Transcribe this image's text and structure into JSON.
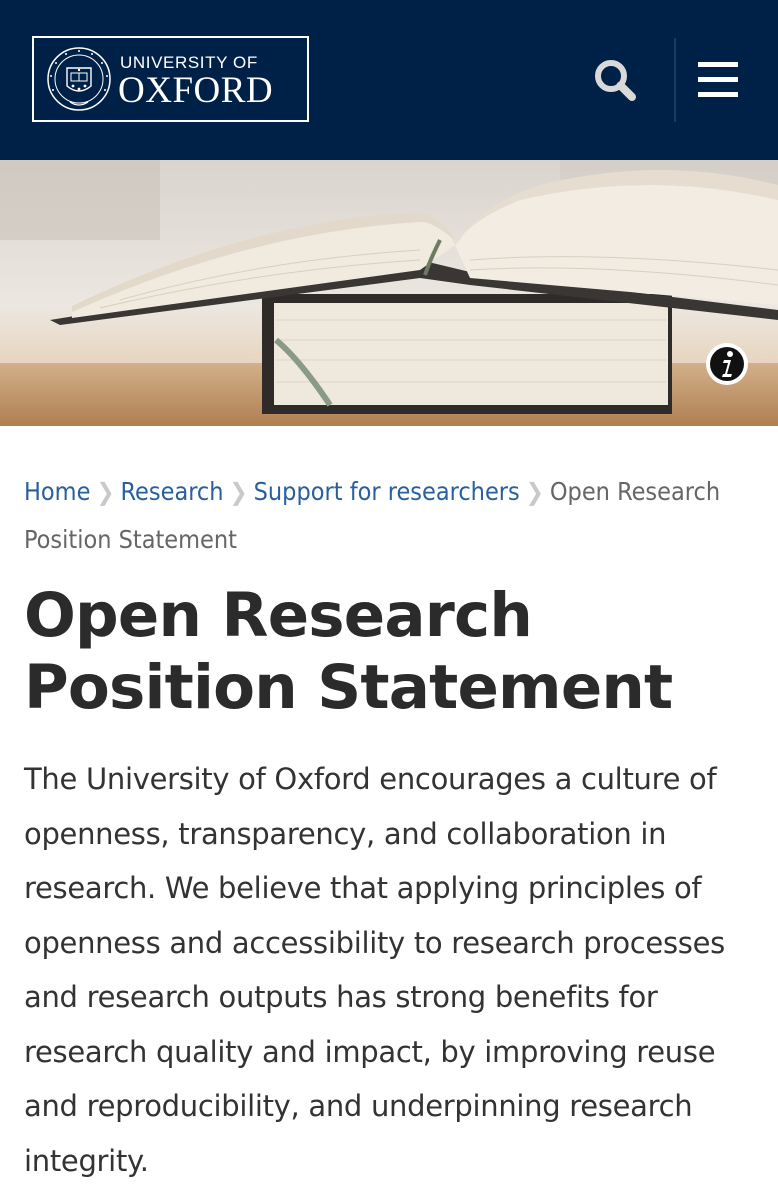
{
  "header": {
    "logo_line1": "UNIVERSITY OF",
    "logo_line2": "OXFORD",
    "background": "#002147",
    "icons": [
      "oxford-crest",
      "search-icon",
      "menu-icon"
    ]
  },
  "hero": {
    "icons": [
      "info-icon"
    ]
  },
  "breadcrumb": {
    "items": [
      "Home",
      "Research",
      "Support for researchers"
    ],
    "current": "Open Research Position Statement",
    "separator": "❯",
    "link_color": "#2a5f9e"
  },
  "page": {
    "title": "Open Research Position Statement",
    "intro": "The University of Oxford encourages a culture of openness, transparency, and collaboration in research. We believe that applying principles of openness and accessibility to research processes and research outputs has strong benefits for research quality and impact, by improving reuse and reproducibility, and underpinning research integrity."
  }
}
